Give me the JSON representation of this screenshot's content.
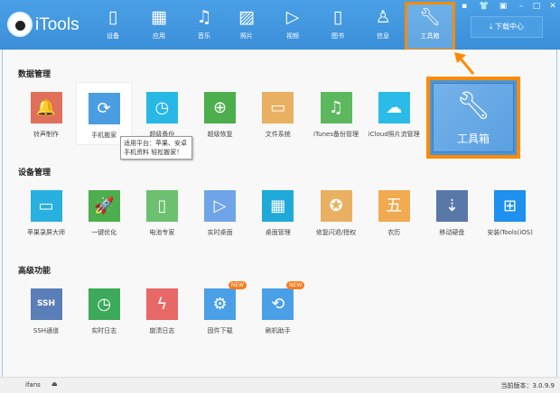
{
  "app": {
    "title": "iTools"
  },
  "nav": [
    {
      "label": "设备",
      "icon": "device-icon"
    },
    {
      "label": "应用",
      "icon": "apps-icon"
    },
    {
      "label": "音乐",
      "icon": "music-icon"
    },
    {
      "label": "照片",
      "icon": "photo-icon"
    },
    {
      "label": "视频",
      "icon": "video-icon"
    },
    {
      "label": "图书",
      "icon": "book-icon"
    },
    {
      "label": "信息",
      "icon": "contact-icon"
    },
    {
      "label": "工具箱",
      "icon": "wrench-icon",
      "selected": true
    }
  ],
  "download_center": "下载中心",
  "sections": [
    {
      "title": "数据管理",
      "items": [
        {
          "label": "铃声制作",
          "color": "#e0705a",
          "glyph": "🔔"
        },
        {
          "label": "手机搬家",
          "color": "#4a9de0",
          "glyph": "⟳"
        },
        {
          "label": "超级备份",
          "color": "#27b8e6",
          "glyph": "◷"
        },
        {
          "label": "超级恢复",
          "color": "#4cae4c",
          "glyph": "⊕"
        },
        {
          "label": "文件系统",
          "color": "#e8b060",
          "glyph": "▭"
        },
        {
          "label": "iTunes备份管理",
          "color": "#5cb85c",
          "glyph": "♫"
        },
        {
          "label": "iCloud照片流管理",
          "color": "#2bbbe8",
          "glyph": "☁"
        }
      ]
    },
    {
      "title": "设备管理",
      "items": [
        {
          "label": "苹果录屏大师",
          "color": "#27b0e0",
          "glyph": "▭"
        },
        {
          "label": "一键优化",
          "color": "#4cae4c",
          "glyph": "🚀"
        },
        {
          "label": "电池专家",
          "color": "#6cc070",
          "glyph": "▯"
        },
        {
          "label": "实时桌面",
          "color": "#6fa5e8",
          "glyph": "▷"
        },
        {
          "label": "桌面管理",
          "color": "#1fa9d8",
          "glyph": "▦"
        },
        {
          "label": "修复闪退/授权",
          "color": "#e8b060",
          "glyph": "✪"
        },
        {
          "label": "农历",
          "color": "#f0aa50",
          "glyph": "五"
        },
        {
          "label": "移动硬盘",
          "color": "#5878a8",
          "glyph": "⇣"
        },
        {
          "label": "安装iTools(iOS)",
          "color": "#1e90f0",
          "glyph": "⊞"
        }
      ]
    },
    {
      "title": "高级功能",
      "items": [
        {
          "label": "SSH通道",
          "color": "#5a7fb8",
          "glyph": "SSH"
        },
        {
          "label": "实时日志",
          "color": "#3caa5a",
          "glyph": "◷"
        },
        {
          "label": "崩溃日志",
          "color": "#e86868",
          "glyph": "ϟ"
        },
        {
          "label": "固件下载",
          "color": "#4aa0e6",
          "glyph": "⚙",
          "badge": "NEW"
        },
        {
          "label": "刷机助手",
          "color": "#4aa0e6",
          "glyph": "⟲",
          "badge": "NEW"
        }
      ]
    }
  ],
  "tooltip": {
    "line1": "适用平台：苹果、安卓",
    "line2": "手机资料 轻松搬家！"
  },
  "highlight": {
    "label": "工具箱"
  },
  "status": {
    "device": "ifans",
    "version": "当前版本：3.0.9.9"
  }
}
